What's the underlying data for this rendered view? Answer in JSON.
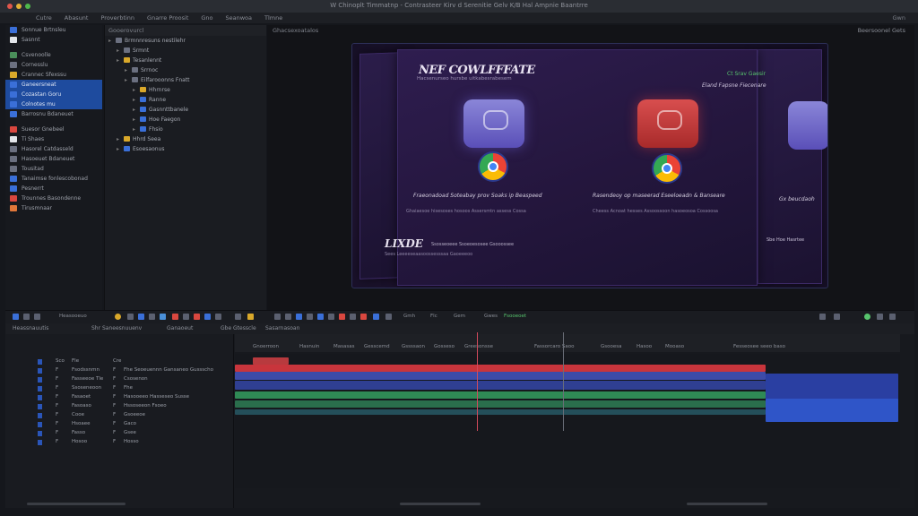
{
  "app": {
    "window_title": "W Chinoplt Timmatnp - Contrasteer Kirv d Serenitie Gelv K/B Hal Ampnie Baantrre",
    "menu": [
      "Cutre",
      "Abasunt",
      "Proverbtinn",
      "Gnarre Proosit",
      "Gno",
      "Seanwoa",
      "Tlmne"
    ],
    "menu_right": "Gwn"
  },
  "colors": {
    "accent": "#1e4b9e",
    "red_track": "#c8353c",
    "blue_track": "#2f55c8",
    "green_track": "#2f8a55"
  },
  "left_panel": {
    "items": [
      {
        "label": "Sonnue Brtnsleu",
        "icon": "app-icon",
        "color": "#3b6fd8",
        "selected": false
      },
      {
        "label": "Sasnnt",
        "icon": "chrome-icon",
        "color": "#e3e6ea",
        "selected": false
      },
      {
        "label": "Csvenoolle",
        "icon": "folder-icon",
        "color": "#4a8f5a",
        "selected": false
      },
      {
        "label": "Cornesslu",
        "icon": "folder-icon",
        "color": "#6b7080",
        "selected": false
      },
      {
        "label": "Crannec Sfexssu",
        "icon": "folder-icon",
        "color": "#d9a82a",
        "selected": false
      },
      {
        "label": "Ganeersneat",
        "icon": "folder-icon",
        "color": "#3a6fd8",
        "selected": true
      },
      {
        "label": "Cozastan Goru",
        "icon": "folder-icon",
        "color": "#3a6fd8",
        "selected": true
      },
      {
        "label": "Colnotes mu",
        "icon": "folder-icon",
        "color": "#3a6fd8",
        "selected": true
      },
      {
        "label": "Barrosnu Bdaneuet",
        "icon": "folder-icon",
        "color": "#3a6fd8",
        "selected": false
      },
      {
        "label": "Suesor Gnebeel",
        "icon": "folder-icon",
        "color": "#d9473f",
        "selected": false
      },
      {
        "label": "Ti Shaes",
        "icon": "folder-icon",
        "color": "#e3e6ea",
        "selected": false
      },
      {
        "label": "Hasorel Catdasseld",
        "icon": "folder-icon",
        "color": "#6b7080",
        "selected": false
      },
      {
        "label": "Hasoeuet Bdaneuet",
        "icon": "folder-icon",
        "color": "#6b7080",
        "selected": false
      },
      {
        "label": "Tousitad",
        "icon": "folder-icon",
        "color": "#6b7080",
        "selected": false
      },
      {
        "label": "Tanaimse fonlescobonad",
        "icon": "folder-icon",
        "color": "#3a6fd8",
        "selected": false
      },
      {
        "label": "Pesnerrt",
        "icon": "folder-icon",
        "color": "#3a6fd8",
        "selected": false
      },
      {
        "label": "Trounnes Basondenne",
        "icon": "folder-icon",
        "color": "#d9473f",
        "selected": false
      },
      {
        "label": "Tirusmnaar",
        "icon": "folder-icon",
        "color": "#e0773a",
        "selected": false
      }
    ]
  },
  "project_tree": {
    "header": "Gooerovurcl",
    "items": [
      {
        "label": "Brmnnresuns nestilehr",
        "depth": 0,
        "color": "#6b7080"
      },
      {
        "label": "Srmnt",
        "depth": 1,
        "color": "#6b7080"
      },
      {
        "label": "Tesanlennt",
        "depth": 1,
        "color": "#d9a82a"
      },
      {
        "label": "Srrnoc",
        "depth": 2,
        "color": "#6b7080"
      },
      {
        "label": "Eilfarooonns Fnatt",
        "depth": 2,
        "color": "#6b7080"
      },
      {
        "label": "Hhrnrse",
        "depth": 3,
        "color": "#d9a82a"
      },
      {
        "label": "Ranne",
        "depth": 3,
        "color": "#3a6fd8"
      },
      {
        "label": "Gasnnttbanele",
        "depth": 3,
        "color": "#3a6fd8"
      },
      {
        "label": "Hoe Faegon",
        "depth": 3,
        "color": "#3a6fd8"
      },
      {
        "label": "Fhsio",
        "depth": 3,
        "color": "#3a6fd8"
      },
      {
        "label": "Hhrd Seea",
        "depth": 1,
        "color": "#d9a82a"
      },
      {
        "label": "Esoesaonus",
        "depth": 1,
        "color": "#3a6fd8"
      }
    ]
  },
  "viewer": {
    "header": "Ghacsexoatalos",
    "header_right": "Beersoonel Gets",
    "title": "NEF COWLFFFATE",
    "subtitle": "Hacsenurseo hursbe uitkabesrabesem",
    "top_right_green": "Ct Srav Gaesir",
    "top_right_white": "Eland Fapsne Fiecenare",
    "caption_left": "Fraeonadoad Soteabay prov Soaks ip Beaspeed",
    "caption_left_small": "Ghaiaesoe hisesoses hosoos  Assersmtn assess  Cossa",
    "caption_right": "Rasendeoy op maseerad Eseeloeadn & Banseare",
    "caption_right_small": "Cheess  Acnoat  hesses  Assoossoon hasoeosoa  Cossoosa",
    "side_right_caption": "Gx beucdaoh",
    "logo": "LIXDE",
    "logo_tags": "Ssosseoeee  Ssoeoesosee  Gsooossee",
    "logo_sub": "Sees  Leeeeseaasoossesssaa  Gaoeeeoo",
    "side_bottom": "Sbe Hoe Hasrtee"
  },
  "viewer_controls": {
    "labels": [
      "Heasooeuo",
      "Gmh",
      "Flc",
      "Gem",
      "Gwes",
      "Fsooeoet"
    ]
  },
  "timeline": {
    "tabs": [
      "Heassnauutis",
      "Shr Saneesnuuenv",
      "Ganaoeut",
      "Gbe Gtesscle",
      "Sasarnasoan"
    ],
    "ruler_labels": [
      "Gnoerroon",
      "Hasnuin",
      "Masasas",
      "Gesscemd",
      "Gssssaon",
      "Gosseso",
      "Greesonsse",
      "Fassorcaro Saoo",
      "Gsooesa",
      "Hasoo",
      "Mooaso",
      "Fesseosee seeo baso"
    ],
    "track_headers": [
      {
        "a": "Sco",
        "b": "Fle",
        "c": "Cre",
        "d": ""
      },
      {
        "a": "F",
        "b": "Fsodssnmn",
        "c": "F",
        "d": "Fhe Seoeuennn Gansaneo Gussscho"
      },
      {
        "a": "F",
        "b": "Fasseeoe Tle",
        "c": "F",
        "d": "Csosenon"
      },
      {
        "a": "F",
        "b": "Ssoseneoon",
        "c": "F",
        "d": "Fhe"
      },
      {
        "a": "F",
        "b": "Fasaoet",
        "c": "F",
        "d": "Hasooeeo Hasseseo Susse"
      },
      {
        "a": "F",
        "b": "Fasoaso",
        "c": "F",
        "d": "Hssoseeon Fsoeo"
      },
      {
        "a": "F",
        "b": "Cooe",
        "c": "F",
        "d": "Gsoeeoe"
      },
      {
        "a": "F",
        "b": "Hsoaee",
        "c": "F",
        "d": "Gaco"
      },
      {
        "a": "F",
        "b": "Fasso",
        "c": "F",
        "d": "Gsee"
      },
      {
        "a": "F",
        "b": "Hosoo",
        "c": "F",
        "d": "Hosso"
      }
    ],
    "timecodes": [
      "F 1",
      "F 1",
      "F"
    ]
  }
}
